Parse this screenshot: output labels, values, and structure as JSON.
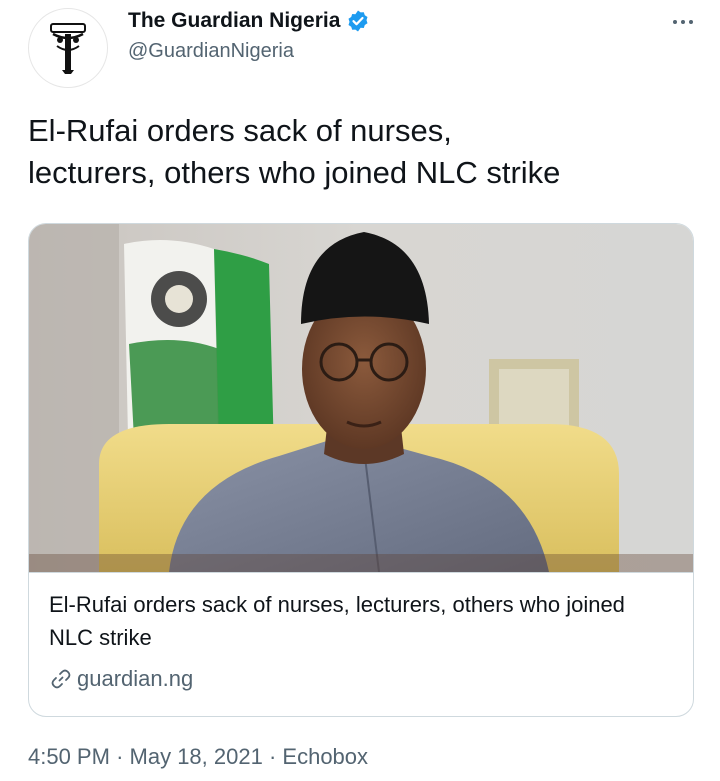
{
  "account": {
    "display_name": "The Guardian Nigeria",
    "handle": "@GuardianNigeria",
    "verified_color": "#1d9bf0",
    "icons": [
      "guardian-logo-icon",
      "verified-badge-icon",
      "more-options-icon"
    ]
  },
  "tweet": {
    "text_line1": "El-Rufai orders sack of nurses,",
    "text_line2": "lecturers, others who joined NLC strike"
  },
  "card": {
    "image_subject": "man in grey kaftan and black cap in front of a Nigerian flag",
    "title": "El-Rufai orders sack of nurses, lecturers, others who joined NLC strike",
    "domain": "guardian.ng",
    "icon": "link-icon"
  },
  "meta": {
    "time": "4:50 PM",
    "separator": "·",
    "date": "May 18, 2021",
    "source": "Echobox"
  }
}
